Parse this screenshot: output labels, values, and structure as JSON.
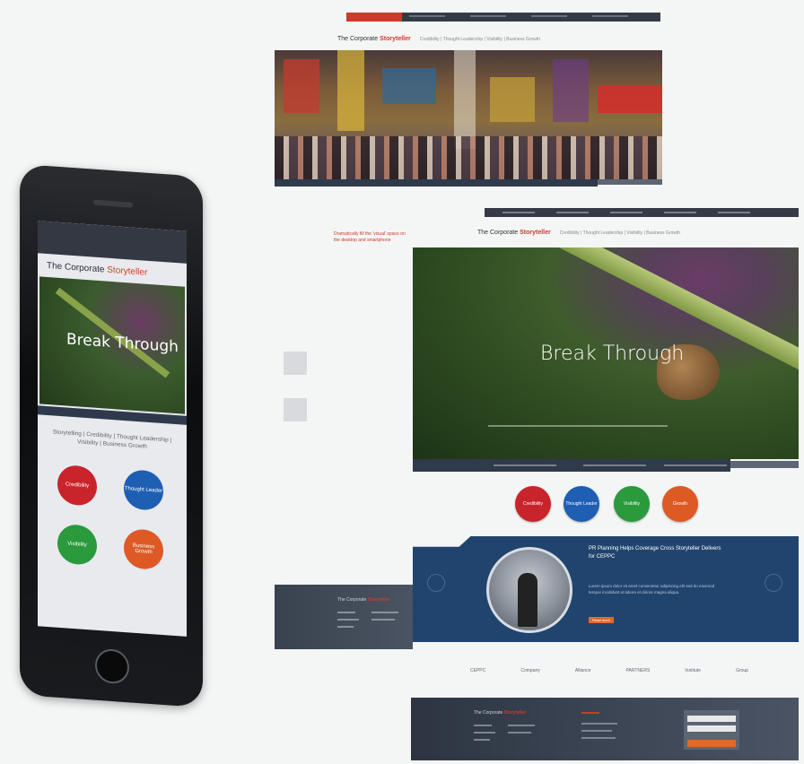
{
  "phone": {
    "logo_prefix": "The Corporate ",
    "logo_accent": "Storyteller",
    "hero_title": "Break Through",
    "tagline": "Storytelling | Credibility | Thought Leadership | Visibility | Business Growth",
    "circles": [
      {
        "label": "Credibility",
        "color": "#c9242b"
      },
      {
        "label": "Thought Leader",
        "color": "#1e5fb3"
      },
      {
        "label": "Visibility",
        "color": "#2a9a3c"
      },
      {
        "label": "Business Growth",
        "color": "#dd5a25"
      }
    ]
  },
  "desktop1": {
    "logo_prefix": "The Corporate ",
    "logo_accent": "Storyteller",
    "logo_tagline": "Credibility | Thought Leadership | Visibility | Business Growth"
  },
  "desktop2": {
    "logo_prefix": "The Corporate ",
    "logo_accent": "Storyteller",
    "logo_tagline": "Credibility | Thought Leadership | Visibility | Business Growth",
    "note": "Dramatically fill the 'visual' space on the desktop and smartphone",
    "hero_title": "Break Through",
    "circles": [
      {
        "label": "Credibility",
        "color": "#c9242b"
      },
      {
        "label": "Thought Leader",
        "color": "#1e5fb3"
      },
      {
        "label": "Visibility",
        "color": "#2a9a3c"
      },
      {
        "label": "Growth",
        "color": "#dd5a25"
      }
    ],
    "feature_title": "PR Planning Helps Coverage Cross Storyteller Delivers for CEPPC",
    "feature_text": "Lorem ipsum dolor sit amet consectetur adipiscing elit sed do eiusmod tempor incididunt ut labore et dolore magna aliqua.",
    "feature_button": "Read more",
    "logos": [
      "CEPPC",
      "Company",
      "Alliance",
      "PARTNERS",
      "Institute",
      "Group"
    ],
    "footer_logo_prefix": "The Corporate ",
    "footer_logo_accent": "Storyteller"
  }
}
